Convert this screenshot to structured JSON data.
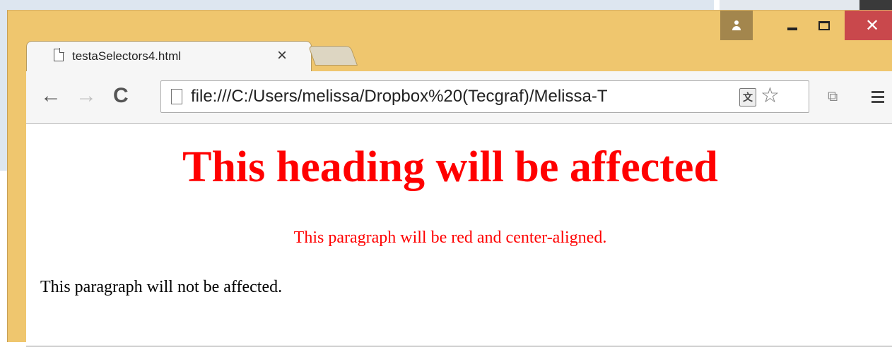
{
  "browser": {
    "tab": {
      "title": "testaSelectors4.html",
      "close_glyph": "×"
    },
    "toolbar": {
      "back_glyph": "←",
      "forward_glyph": "→",
      "reload_glyph": "C",
      "url": "file:///C:/Users/melissa/Dropbox%20(Tecgraf)/Melissa-T",
      "translate_glyph": "文",
      "star_glyph": "☆",
      "extension_glyph": "⧉"
    },
    "window_controls": {
      "close_glyph": "✕"
    }
  },
  "page": {
    "heading": "This heading will be affected",
    "red_paragraph": "This paragraph will be red and center-aligned.",
    "plain_paragraph": "This paragraph will not be affected."
  },
  "colors": {
    "frame": "#efc66e",
    "close_button": "#c9484c",
    "user_button": "#a3864d",
    "heading_red": "#ff0000"
  },
  "icons": [
    "document-icon",
    "user-icon",
    "minimize-icon",
    "maximize-icon",
    "close-icon",
    "back-icon",
    "forward-icon",
    "reload-icon",
    "translate-icon",
    "star-icon",
    "extensions-icon",
    "menu-icon"
  ]
}
